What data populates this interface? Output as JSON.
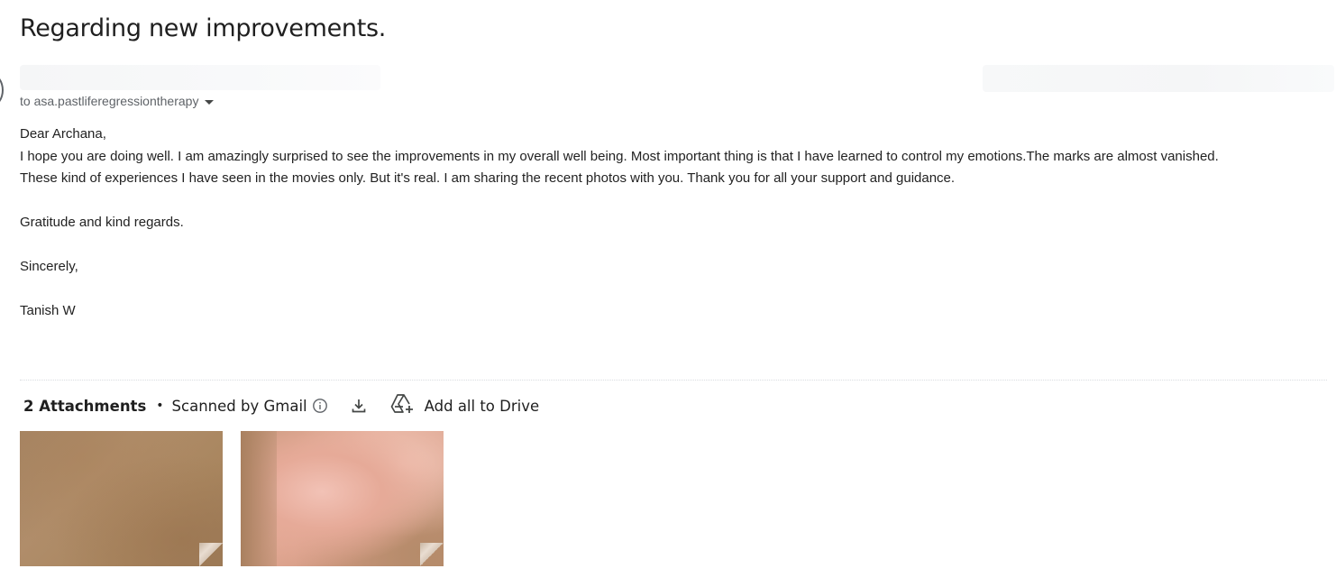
{
  "subject": "Regarding new improvements.",
  "recipient": {
    "text": "to asa.pastliferegressiontherapy"
  },
  "body": {
    "greeting": "Dear Archana,",
    "line1": "I hope you are doing well. I am amazingly surprised to see the improvements in my overall well being. Most important thing is that I have learned to control my emotions.The marks are almost vanished.",
    "line2": "These kind of experiences I have seen in the movies only. But it's real. I am sharing the recent photos with you. Thank you for all your support and guidance.",
    "closing1": "Gratitude and kind regards.",
    "closing2": "Sincerely,",
    "signature": "Tanish W"
  },
  "attachments": {
    "count_label": "2 Attachments",
    "separator": "•",
    "scanned_label": "Scanned by Gmail",
    "add_drive_label": "Add all to Drive",
    "items": [
      {
        "kind": "image",
        "icon": "skin-photo"
      },
      {
        "kind": "image",
        "icon": "skin-photo"
      }
    ]
  },
  "colors": {
    "text": "#222222",
    "secondary": "#5f6368",
    "icon": "#444746"
  }
}
